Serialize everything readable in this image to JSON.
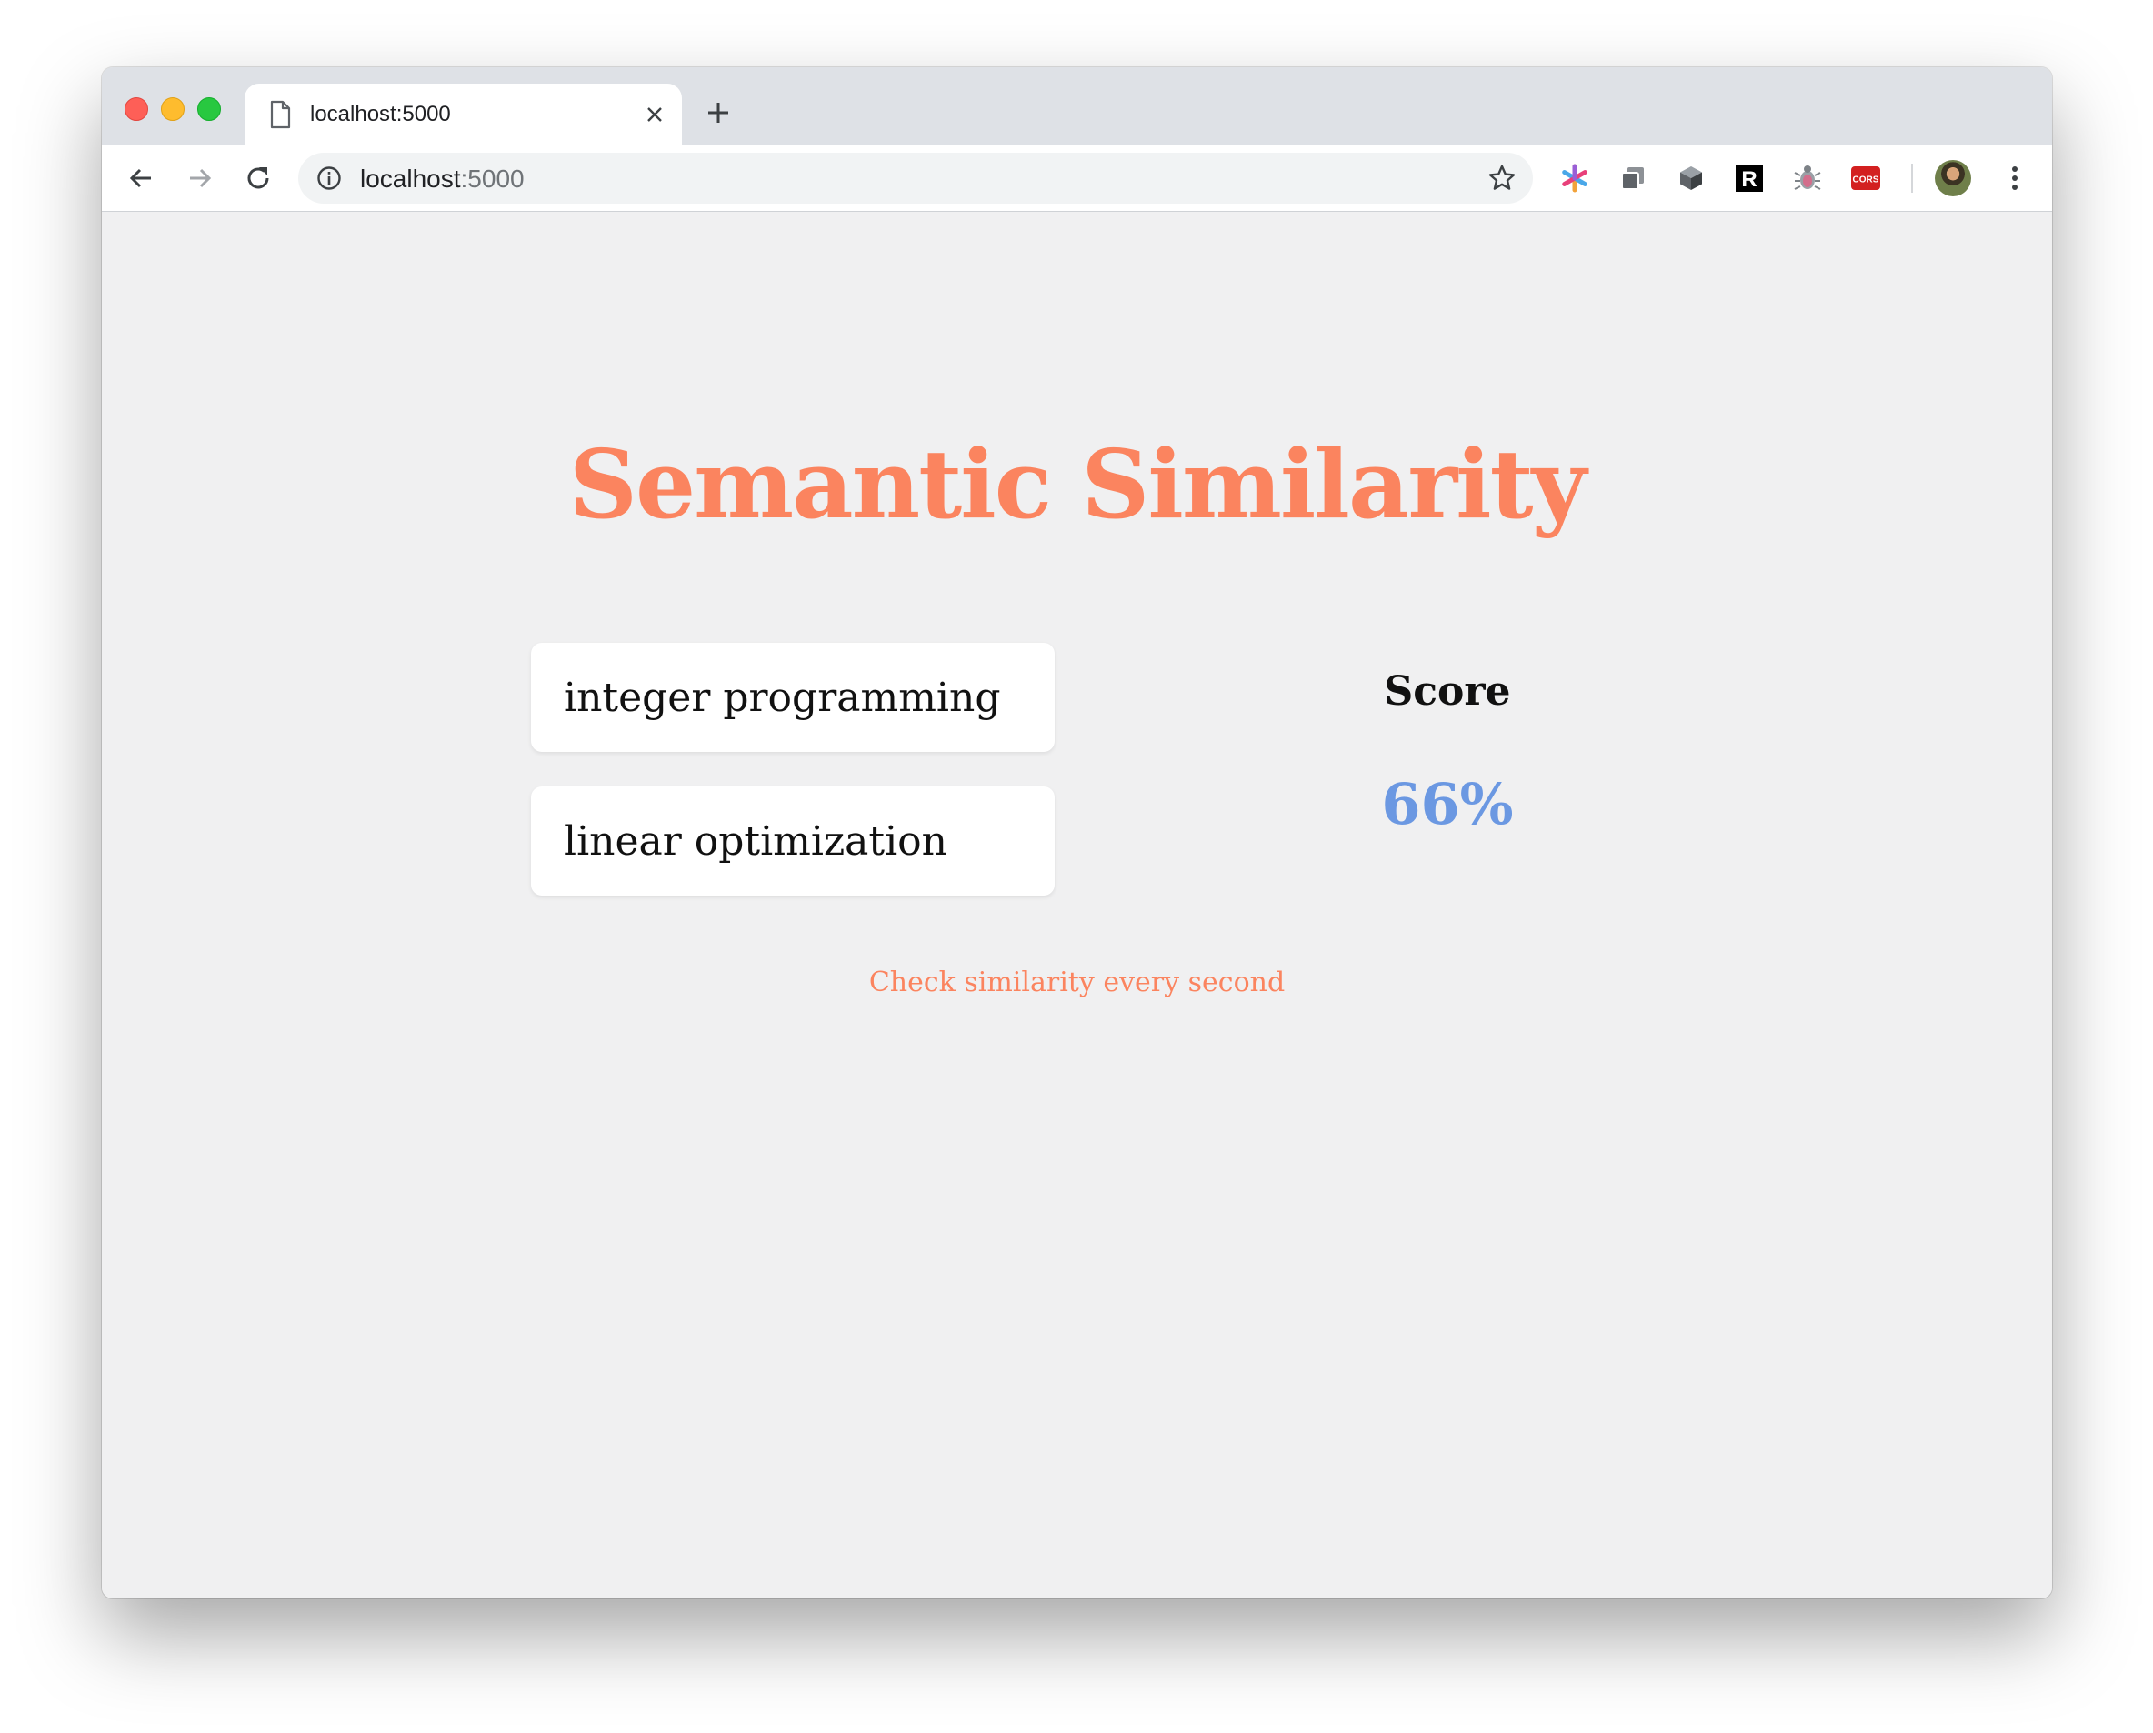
{
  "browser": {
    "tab_title": "localhost:5000",
    "url_host": "localhost",
    "url_port": ":5000",
    "extensions": [
      "asterisk-extension-icon",
      "copy-extension-icon",
      "cube-extension-icon",
      "r-extension-icon",
      "bug-extension-icon",
      "cors-extension-icon"
    ],
    "cors_badge": "CORS",
    "r_badge": "R"
  },
  "app": {
    "title": "Semantic Similarity",
    "input_1": "integer programming",
    "input_2": "linear optimization",
    "score_label": "Score",
    "score_value": "66%",
    "check_label": "Check similarity every second"
  },
  "colors": {
    "accent": "#fb845f",
    "score": "#6b98e2",
    "page_bg": "#f0f0f1"
  }
}
